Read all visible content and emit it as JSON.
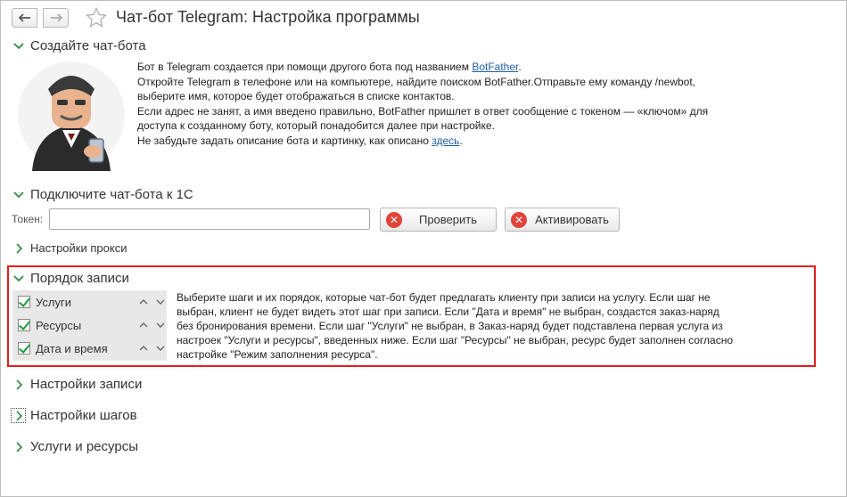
{
  "window": {
    "title": "Чат-бот Telegram: Настройка программы"
  },
  "sections": {
    "create_bot": {
      "header": "Создайте чат-бота",
      "intro_line1_a": "Бот в Telegram создается при помощи другого бота под названием ",
      "intro_line1_link": "BotFather",
      "intro_line1_b": ".",
      "intro_line2": "Откройте Telegram в телефоне или на компьютере, найдите поиском BotFather.Отправьте ему команду /newbot,",
      "intro_line3": "выберите имя, которое будет отображаться в списке контактов.",
      "intro_line4": "Если адрес не занят, а имя введено правильно, BotFather пришлет в ответ сообщение с токеном — «ключом» для",
      "intro_line5": "доступа к созданному боту, который понадобится далее при настройке.",
      "intro_line6_a": "Не забудьте задать описание бота и картинку, как описано ",
      "intro_line6_link": "здесь",
      "intro_line6_b": "."
    },
    "connect_bot": {
      "header": "Подключите чат-бота к 1С",
      "token_label": "Токен:",
      "token_value": "",
      "check_button": "Проверить",
      "activate_button": "Активировать",
      "proxy_settings": "Настройки прокси"
    },
    "record_order": {
      "header": "Порядок записи",
      "steps": [
        {
          "label": "Услуги",
          "checked": true
        },
        {
          "label": "Ресурсы",
          "checked": true
        },
        {
          "label": "Дата и время",
          "checked": true
        }
      ],
      "description_1": "Выберите шаги и их порядок, которые чат-бот будет предлагать клиенту при записи на услугу. Если шаг не",
      "description_2": "выбран, клиент не будет видеть этот шаг при записи. Если \"Дата и время\" не выбран, создастся заказ-наряд",
      "description_3": "без бронирования времени. Если шаг \"Услуги\" не выбран, в Заказ-наряд будет подставлена первая услуга из",
      "description_4": "настроек \"Услуги и ресурсы\", введенных ниже. Если шаг \"Ресурсы\" не выбран, ресурс будет заполнен согласно",
      "description_5": "настройке \"Режим заполнения ресурса\"."
    },
    "record_settings": {
      "header": "Настройки записи"
    },
    "step_settings": {
      "header": "Настройки шагов"
    },
    "services_resources": {
      "header": "Услуги и ресурсы"
    }
  },
  "icons": {
    "back": "arrow-left-icon",
    "forward": "arrow-right-icon",
    "favorite": "star-outline-icon",
    "expanded": "chevron-down-icon",
    "collapsed": "chevron-right-icon",
    "error": "x-circle-icon",
    "move_up": "chevron-up-icon",
    "move_down": "chevron-down-icon"
  },
  "colors": {
    "accent_green": "#1b9e3a",
    "error_red": "#e0443a",
    "highlight_red": "#e01f1f",
    "link_blue": "#1f5fa6"
  }
}
